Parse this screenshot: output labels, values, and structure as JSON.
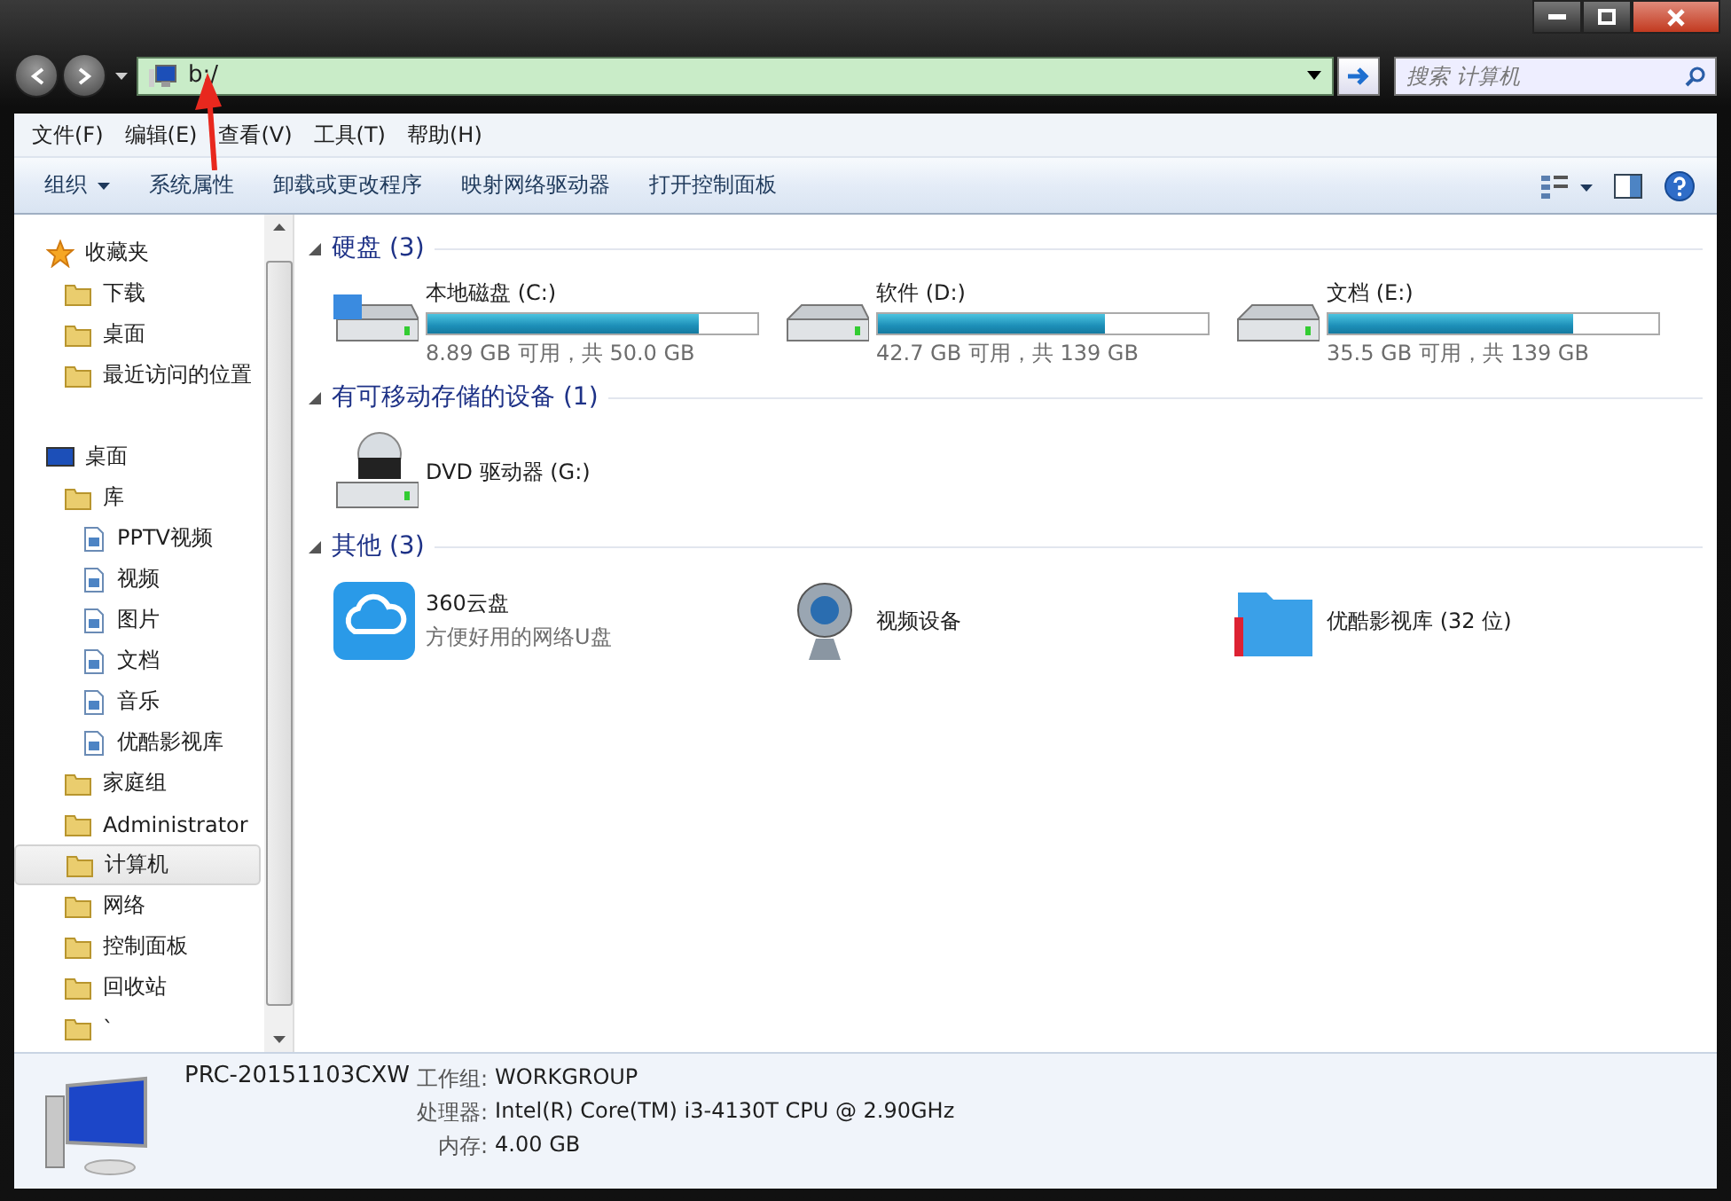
{
  "window": {
    "address": "b:/",
    "search": {
      "placeholder": "搜索 计算机"
    }
  },
  "menu": [
    "文件(F)",
    "编辑(E)",
    "查看(V)",
    "工具(T)",
    "帮助(H)"
  ],
  "toolbar": [
    {
      "label": "组织",
      "dropdown": true
    },
    {
      "label": "系统属性",
      "dropdown": false
    },
    {
      "label": "卸载或更改程序",
      "dropdown": false
    },
    {
      "label": "映射网络驱动器",
      "dropdown": false
    },
    {
      "label": "打开控制面板",
      "dropdown": false
    }
  ],
  "sidebar": {
    "items": [
      {
        "label": "收藏夹",
        "selected": false,
        "children": [
          {
            "label": "下载",
            "selected": false
          },
          {
            "label": "桌面",
            "selected": false
          },
          {
            "label": "最近访问的位置",
            "selected": false
          }
        ]
      },
      {
        "label": "桌面",
        "selected": false,
        "children": [
          {
            "label": "库",
            "selected": false,
            "children": [
              {
                "label": "PPTV视频",
                "selected": false
              },
              {
                "label": "视频",
                "selected": false
              },
              {
                "label": "图片",
                "selected": false
              },
              {
                "label": "文档",
                "selected": false
              },
              {
                "label": "音乐",
                "selected": false
              },
              {
                "label": "优酷影视库",
                "selected": false
              }
            ]
          },
          {
            "label": "家庭组",
            "selected": false
          },
          {
            "label": "Administrator",
            "selected": false
          },
          {
            "label": "计算机",
            "selected": true
          },
          {
            "label": "网络",
            "selected": false
          },
          {
            "label": "控制面板",
            "selected": false
          },
          {
            "label": "回收站",
            "selected": false
          },
          {
            "label": "`",
            "selected": false
          }
        ]
      }
    ]
  },
  "groups": [
    {
      "title": "硬盘 (3)",
      "expanded": true,
      "items": [
        {
          "kind": "drive",
          "name": "本地磁盘 (C:)",
          "detail": "8.89 GB 可用，共 50.0 GB",
          "level": 0.82
        },
        {
          "kind": "drive",
          "name": "软件 (D:)",
          "detail": "42.7 GB 可用，共 139 GB",
          "level": 0.69
        },
        {
          "kind": "drive",
          "name": "文档 (E:)",
          "detail": "35.5 GB 可用，共 139 GB",
          "level": 0.74
        }
      ]
    },
    {
      "title": "有可移动存储的设备 (1)",
      "expanded": true,
      "items": [
        {
          "kind": "dvd",
          "name": "DVD 驱动器 (G:)"
        }
      ]
    },
    {
      "title": "其他 (3)",
      "expanded": true,
      "items": [
        {
          "kind": "cloud",
          "name": "360云盘",
          "detail": "方便好用的网络U盘"
        },
        {
          "kind": "webcam",
          "name": "视频设备"
        },
        {
          "kind": "folder",
          "name": "优酷影视库 (32 位)"
        }
      ]
    }
  ],
  "details": {
    "name": "PRC-20151103CXW",
    "fields": [
      {
        "label": "工作组:",
        "value": "WORKGROUP"
      },
      {
        "label": "处理器:",
        "value": "Intel(R) Core(TM) i3-4130T CPU @ 2.90GHz"
      },
      {
        "label": "内存:",
        "value": "4.00 GB"
      }
    ]
  }
}
